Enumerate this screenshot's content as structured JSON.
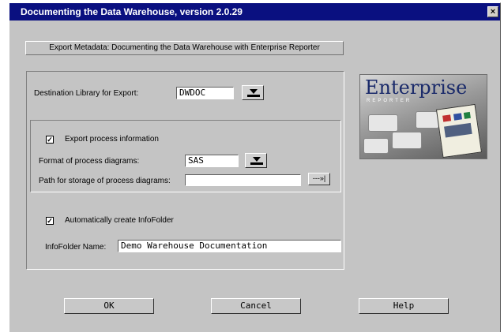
{
  "window": {
    "title": "Documenting the Data Warehouse, version 2.0.29",
    "close_glyph": "×"
  },
  "header": {
    "text": "Export Metadata: Documenting the Data Warehouse with Enterprise Reporter"
  },
  "destination": {
    "label": "Destination Library for Export:",
    "value": "DWDOC"
  },
  "process": {
    "export_checkbox_label": "Export process information",
    "export_checked": true,
    "format_label": "Format of process diagrams:",
    "format_value": "SAS",
    "path_label": "Path for storage of process diagrams:",
    "path_value": ""
  },
  "infofolder": {
    "auto_checkbox_label": "Automatically create InfoFolder",
    "auto_checked": true,
    "name_label": "InfoFolder Name:",
    "name_value": "Demo Warehouse Documentation"
  },
  "logo": {
    "brand": "Enterprise",
    "subtitle": "REPORTER"
  },
  "buttons": {
    "ok": "OK",
    "cancel": "Cancel",
    "help": "Help"
  },
  "glyphs": {
    "check": "✓",
    "browse": "---»|"
  },
  "colors": {
    "titlebar": "#0a1080",
    "window_bg": "#c8c8c8"
  }
}
